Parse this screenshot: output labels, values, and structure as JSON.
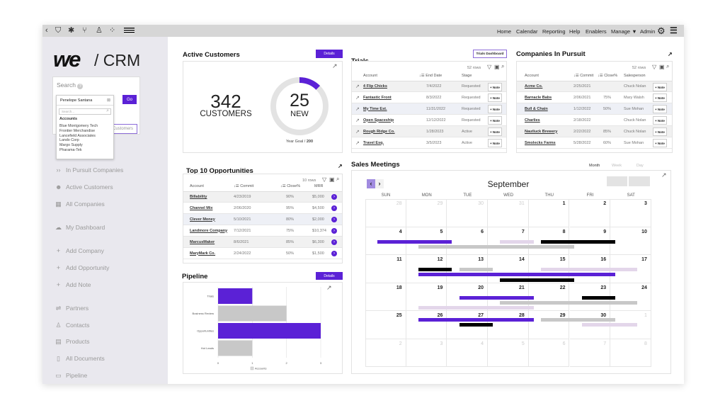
{
  "topbar": {
    "icons": [
      "back-chevron-icon",
      "shield-check-icon",
      "bug-icon",
      "branch-icon",
      "user-icon",
      "spinner-icon",
      "flag-icon"
    ],
    "menu": [
      "Home",
      "Calendar",
      "Reporting",
      "Help",
      "Enablers",
      "Manage",
      "Admin"
    ]
  },
  "logo": {
    "brand": "we",
    "product": "/ CRM"
  },
  "search": {
    "label": "Search",
    "go": "Go",
    "scope_value": "Customers",
    "dropdown": {
      "selected": "Penelope Santana",
      "placeholder": "Search...",
      "group": "Accounts",
      "items": [
        "Blue Montgomery Tech",
        "Frontier Merchandise",
        "Lancefield Associates",
        "Lando Corp",
        "Margo Supply",
        "Pharama-Tek"
      ]
    }
  },
  "sidebar": {
    "items": [
      {
        "label": "In Pursuit Companies",
        "icon": "›› "
      },
      {
        "label": "Active Customers",
        "icon": "☻"
      },
      {
        "label": "All Companies",
        "icon": "▦"
      },
      {
        "label": "My Dashboard",
        "icon": "☁"
      },
      {
        "label": "Add Company",
        "icon": "+"
      },
      {
        "label": "Add Opportunity",
        "icon": "+"
      },
      {
        "label": "Add Note",
        "icon": "+"
      },
      {
        "label": "Partners",
        "icon": "⇌"
      },
      {
        "label": "Contacts",
        "icon": "♙"
      },
      {
        "label": "Products",
        "icon": "▤"
      },
      {
        "label": "All Documents",
        "icon": "▯"
      },
      {
        "label": "Pipeline",
        "icon": "▭"
      }
    ]
  },
  "active_customers": {
    "title": "Active Customers",
    "details": "Details",
    "count": "342",
    "count_label": "CUSTOMERS",
    "new": "25",
    "new_label": "NEW",
    "goal_label": "Year Goal /",
    "goal": "200",
    "progress": 0.125,
    "accent": "#5b21d6"
  },
  "trials": {
    "title": "Trials",
    "dashboard_button": "Trials Dashboard",
    "rows_count": "52 rows",
    "headers": [
      "Account",
      "End Date",
      "Stage"
    ],
    "note": "+ Note",
    "rows": [
      [
        "4 Flip Chicks",
        "7/4/2022",
        "Requested"
      ],
      [
        "Fantastic Front",
        "8/3/2022",
        "Requested"
      ],
      [
        "My Time Est.",
        "11/31/2022",
        "Requested"
      ],
      [
        "Open Spaceship",
        "12/12/2022",
        "Requested"
      ],
      [
        "Rough Ridge Co.",
        "1/28/2023",
        "Active"
      ],
      [
        "Travel Esq.",
        "3/5/2023",
        "Active"
      ]
    ]
  },
  "pursuit": {
    "title": "Companies In Pursuit",
    "rows_count": "52 rows",
    "headers": [
      "Account",
      "Commit",
      "Close%",
      "Salesperson"
    ],
    "note": "+ Note",
    "rows": [
      [
        "Acme Co.",
        "2/25/2021",
        "",
        "Chuck Nolan"
      ],
      [
        "Barnacle Babs",
        "2/06/2021",
        "75%",
        "Mary Walsh"
      ],
      [
        "Bull & Chain",
        "1/12/2022",
        "50%",
        "Sue Mohan"
      ],
      [
        "Charlies",
        "2/18/2022",
        "",
        "Chuck Nolan"
      ],
      [
        "Nautluck Brewery",
        "2/22/2022",
        "85%",
        "Chuck Nolan"
      ],
      [
        "Smolecks Farms",
        "5/28/2022",
        "60%",
        "Sue Mohan"
      ]
    ]
  },
  "top10": {
    "title": "Top 10 Opportunities",
    "rows_count": "10 rows",
    "headers": [
      "Account",
      "Commit",
      "Close%",
      "MRR"
    ],
    "rows": [
      [
        "Billability",
        "4/23/2019",
        "90%",
        "$5,000"
      ],
      [
        "Channel Mix",
        "2/06/2020",
        "95%",
        "$4,500"
      ],
      [
        "Clever Money",
        "5/10/2021",
        "80%",
        "$2,000"
      ],
      [
        "Landmore Company",
        "7/12/2021",
        "75%",
        "$10,374"
      ],
      [
        "MarcusMaker",
        "8/6/2021",
        "85%",
        "$6,300"
      ],
      [
        "MaryMark Co.",
        "2/24/2022",
        "50%",
        "$1,500"
      ]
    ]
  },
  "pipeline": {
    "title": "Pipeline",
    "details": "Details"
  },
  "chart_data": {
    "type": "bar",
    "orientation": "horizontal",
    "categories": [
      "Trials",
      "Business Review",
      "Opportunities",
      "Hot Leads"
    ],
    "series": [
      {
        "name": "Accounts",
        "values": [
          1,
          2,
          3,
          1
        ]
      }
    ],
    "colors": [
      "#5b21d6",
      "#c8c8c8",
      "#5b21d6",
      "#c8c8c8"
    ],
    "xlim": [
      0,
      3
    ],
    "xticks": [
      "0",
      "1",
      "2",
      "3"
    ],
    "grid": true,
    "legend": "bottom"
  },
  "calendar": {
    "title": "Sales Meetings",
    "views": [
      "Month",
      "Week",
      "Day"
    ],
    "month": "September",
    "weekdays": [
      "SUN",
      "MON",
      "TUE",
      "WED",
      "THU",
      "FRI",
      "SAT"
    ],
    "days": [
      28,
      29,
      30,
      31,
      1,
      2,
      3,
      4,
      5,
      6,
      7,
      8,
      9,
      10,
      11,
      12,
      13,
      14,
      15,
      16,
      17,
      18,
      19,
      20,
      21,
      22,
      23,
      24,
      25,
      26,
      27,
      28,
      29,
      30,
      1,
      2,
      3,
      4,
      5,
      6,
      7,
      8
    ],
    "colors": {
      "purple": "#5b21d6",
      "black": "#000000",
      "gray": "#c8c8c8",
      "lavender": "#e3d6ea"
    },
    "events": [
      {
        "start": "Sep 4",
        "end": "Sep 5",
        "color": "purple"
      },
      {
        "start": "Sep 5",
        "end": "Sep 8",
        "color": "gray"
      },
      {
        "start": "Sep 7",
        "end": "Sep 7",
        "color": "lavender"
      },
      {
        "start": "Sep 8",
        "end": "Sep 9",
        "color": "black"
      },
      {
        "start": "Sep 12",
        "end": "Sep 12",
        "color": "black"
      },
      {
        "start": "Sep 13",
        "end": "Sep 13",
        "color": "gray"
      },
      {
        "start": "Sep 15",
        "end": "Sep 17",
        "color": "lavender"
      },
      {
        "start": "Sep 12",
        "end": "Sep 16",
        "color": "purple"
      },
      {
        "start": "Sep 14",
        "end": "Sep 15",
        "color": "black"
      },
      {
        "start": "Sep 20",
        "end": "Sep 21",
        "color": "purple"
      },
      {
        "start": "Sep 23",
        "end": "Sep 23",
        "color": "black"
      },
      {
        "start": "Sep 21",
        "end": "Sep 24",
        "color": "gray"
      },
      {
        "start": "Sep 19",
        "end": "Sep 21",
        "color": "lavender"
      },
      {
        "start": "Sep 26",
        "end": "Sep 28",
        "color": "purple"
      },
      {
        "start": "Sep 29",
        "end": "Sep 30",
        "color": "gray"
      },
      {
        "start": "Sep 27",
        "end": "Sep 27",
        "color": "black"
      },
      {
        "start": "Sep 30",
        "end": "Oct 1",
        "color": "lavender"
      }
    ]
  }
}
